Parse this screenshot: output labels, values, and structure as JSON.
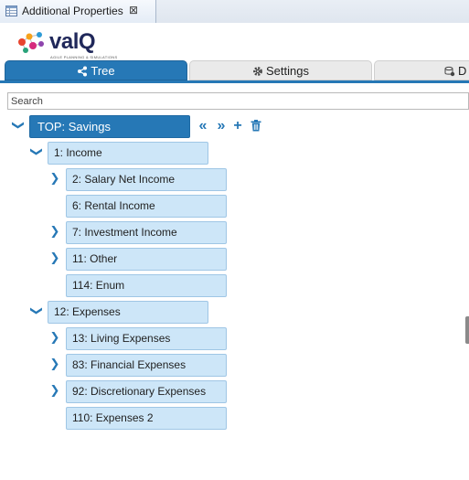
{
  "panel": {
    "title": "Additional Properties",
    "close_glyph": "⊠",
    "icon": "properties-table-icon"
  },
  "logo": {
    "word": "valQ",
    "tagline": "AGILE PLANNING & SIMULATIONS",
    "colors": [
      "#e8442e",
      "#f7a21b",
      "#2e9bd6",
      "#8e44ad",
      "#d6297c",
      "#29a37a"
    ]
  },
  "tabs": [
    {
      "label": "Tree",
      "icon": "share-icon",
      "active": true
    },
    {
      "label": "Settings",
      "icon": "gear-icon",
      "active": false
    },
    {
      "label": "D",
      "icon": "data-icon",
      "active": false
    }
  ],
  "search": {
    "placeholder": "Search",
    "value": ""
  },
  "tree": {
    "root": {
      "label": "TOP: Savings",
      "toggle": "❯",
      "actions": [
        {
          "name": "collapse-all",
          "glyph": "«"
        },
        {
          "name": "expand-all",
          "glyph": "»"
        },
        {
          "name": "add",
          "glyph": "+"
        },
        {
          "name": "delete",
          "glyph": "🗑"
        }
      ]
    },
    "groups": [
      {
        "label": "1: Income",
        "expanded": true,
        "children": [
          {
            "label": "2: Salary Net Income",
            "has_children": true
          },
          {
            "label": "6: Rental Income",
            "has_children": false
          },
          {
            "label": "7: Investment Income",
            "has_children": true
          },
          {
            "label": "11: Other",
            "has_children": true
          },
          {
            "label": "114: Enum",
            "has_children": false
          }
        ]
      },
      {
        "label": "12: Expenses",
        "expanded": true,
        "children": [
          {
            "label": "13: Living Expenses",
            "has_children": true
          },
          {
            "label": "83: Financial Expenses",
            "has_children": true
          },
          {
            "label": "92: Discretionary Expenses",
            "has_children": true
          },
          {
            "label": "110: Expenses 2",
            "has_children": false
          }
        ]
      }
    ]
  },
  "colors": {
    "accent": "#2678b6",
    "node_fill": "#cde6f8",
    "node_border": "#9fc6e5"
  }
}
